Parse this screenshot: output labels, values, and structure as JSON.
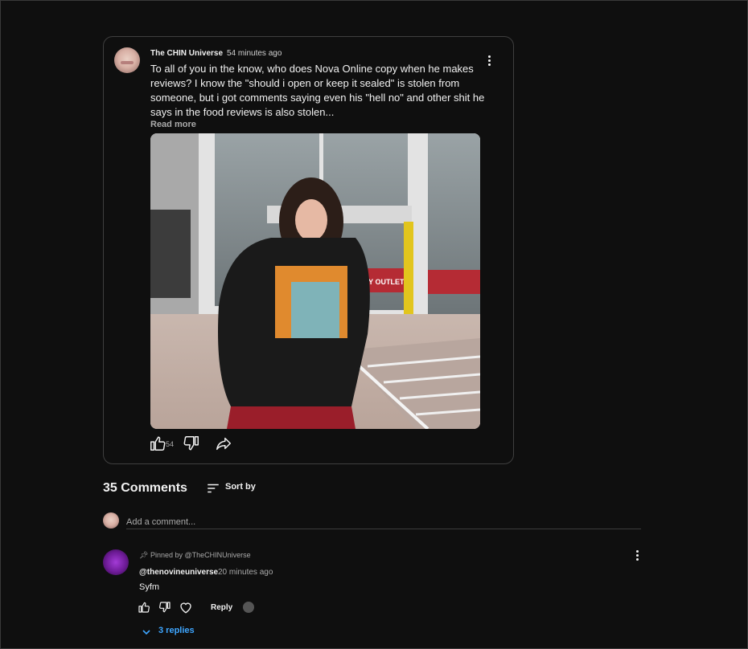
{
  "post": {
    "author": "The CHIN Universe",
    "time": "54 minutes ago",
    "text": "To all of you in the know, who does Nova Online copy when he makes reviews? I know the \"should i open or keep it sealed\" is stolen from someone, but i got comments saying even his \"hell no\" and other shit he says in the food reviews is also stolen...",
    "read_more": "Read more",
    "like_count": "54",
    "storefront_sign": "GROCERY OUTLET"
  },
  "comments_section": {
    "count_label": "35 Comments",
    "sort_label": "Sort by",
    "add_placeholder": "Add a comment..."
  },
  "comment": {
    "pinned_label": "Pinned by @TheCHINUniverse",
    "author": "@thenovineuniverse",
    "time": "20 minutes ago",
    "text": "Syfm",
    "reply_label": "Reply",
    "replies_label": "3 replies"
  },
  "colors": {
    "background": "#0f0f0f",
    "link": "#3ea6ff",
    "text": "#f1f1f1",
    "muted": "#aaaaaa"
  },
  "icons": [
    "thumb-up-icon",
    "thumb-down-icon",
    "share-icon",
    "more-vert-icon",
    "sort-icon",
    "pin-icon",
    "heart-icon",
    "chevron-down-icon"
  ]
}
